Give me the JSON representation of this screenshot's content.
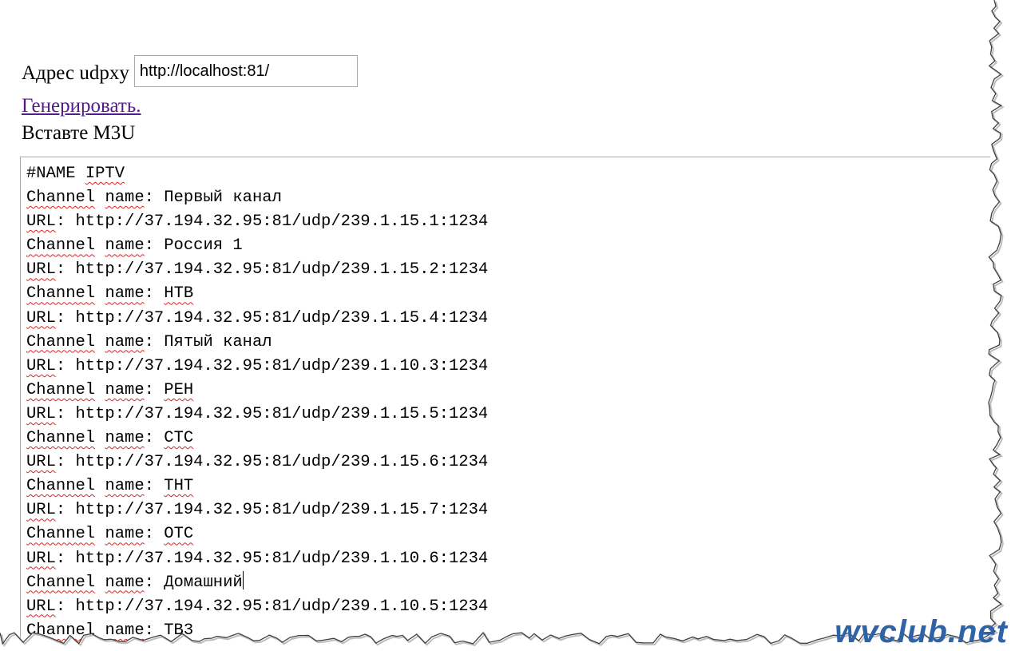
{
  "form": {
    "address_label": "Адрес udpxy",
    "address_value": "http://localhost:81/",
    "generate_link": "Генерировать.",
    "m3u_label": "Вставте M3U"
  },
  "textarea": {
    "lines": [
      {
        "parts": [
          {
            "text": "#NAME",
            "spell": false
          },
          {
            "text": " ",
            "spell": false
          },
          {
            "text": "IPTV",
            "spell": true
          }
        ]
      },
      {
        "parts": [
          {
            "text": "Channel",
            "spell": true
          },
          {
            "text": " ",
            "spell": false
          },
          {
            "text": "name",
            "spell": true
          },
          {
            "text": ": Первый канал",
            "spell": false
          }
        ]
      },
      {
        "parts": [
          {
            "text": "URL",
            "spell": true
          },
          {
            "text": ": http://37.194.32.95:81/udp/239.1.15.1:1234",
            "spell": false
          }
        ]
      },
      {
        "parts": [
          {
            "text": "Channel",
            "spell": true
          },
          {
            "text": " ",
            "spell": false
          },
          {
            "text": "name",
            "spell": true
          },
          {
            "text": ": Россия 1",
            "spell": false
          }
        ]
      },
      {
        "parts": [
          {
            "text": "URL",
            "spell": true
          },
          {
            "text": ": http://37.194.32.95:81/udp/239.1.15.2:1234",
            "spell": false
          }
        ]
      },
      {
        "parts": [
          {
            "text": "Channel",
            "spell": true
          },
          {
            "text": " ",
            "spell": false
          },
          {
            "text": "name",
            "spell": true
          },
          {
            "text": ": ",
            "spell": false
          },
          {
            "text": "НТВ",
            "spell": true
          }
        ]
      },
      {
        "parts": [
          {
            "text": "URL",
            "spell": true
          },
          {
            "text": ": http://37.194.32.95:81/udp/239.1.15.4:1234",
            "spell": false
          }
        ]
      },
      {
        "parts": [
          {
            "text": "Channel",
            "spell": true
          },
          {
            "text": " ",
            "spell": false
          },
          {
            "text": "name",
            "spell": true
          },
          {
            "text": ": Пятый канал",
            "spell": false
          }
        ]
      },
      {
        "parts": [
          {
            "text": "URL",
            "spell": true
          },
          {
            "text": ": http://37.194.32.95:81/udp/239.1.10.3:1234",
            "spell": false
          }
        ]
      },
      {
        "parts": [
          {
            "text": "Channel",
            "spell": true
          },
          {
            "text": " ",
            "spell": false
          },
          {
            "text": "name",
            "spell": true
          },
          {
            "text": ": ",
            "spell": false
          },
          {
            "text": "РЕН",
            "spell": true
          }
        ]
      },
      {
        "parts": [
          {
            "text": "URL",
            "spell": true
          },
          {
            "text": ": http://37.194.32.95:81/udp/239.1.15.5:1234",
            "spell": false
          }
        ]
      },
      {
        "parts": [
          {
            "text": "Channel",
            "spell": true
          },
          {
            "text": " ",
            "spell": false
          },
          {
            "text": "name",
            "spell": true
          },
          {
            "text": ": ",
            "spell": false
          },
          {
            "text": "СТС",
            "spell": true
          }
        ]
      },
      {
        "parts": [
          {
            "text": "URL",
            "spell": true
          },
          {
            "text": ": http://37.194.32.95:81/udp/239.1.15.6:1234",
            "spell": false
          }
        ]
      },
      {
        "parts": [
          {
            "text": "Channel",
            "spell": true
          },
          {
            "text": " ",
            "spell": false
          },
          {
            "text": "name",
            "spell": true
          },
          {
            "text": ": ",
            "spell": false
          },
          {
            "text": "ТНТ",
            "spell": true
          }
        ]
      },
      {
        "parts": [
          {
            "text": "URL",
            "spell": true
          },
          {
            "text": ": http://37.194.32.95:81/udp/239.1.15.7:1234",
            "spell": false
          }
        ]
      },
      {
        "parts": [
          {
            "text": "Channel",
            "spell": true
          },
          {
            "text": " ",
            "spell": false
          },
          {
            "text": "name",
            "spell": true
          },
          {
            "text": ": ",
            "spell": false
          },
          {
            "text": "ОТС",
            "spell": true
          }
        ]
      },
      {
        "parts": [
          {
            "text": "URL",
            "spell": true
          },
          {
            "text": ": http://37.194.32.95:81/udp/239.1.10.6:1234",
            "spell": false
          }
        ]
      },
      {
        "parts": [
          {
            "text": "Channel",
            "spell": true
          },
          {
            "text": " ",
            "spell": false
          },
          {
            "text": "name",
            "spell": true
          },
          {
            "text": ": Домашний",
            "spell": false
          }
        ],
        "caret": true
      },
      {
        "parts": [
          {
            "text": "URL",
            "spell": true
          },
          {
            "text": ": http://37.194.32.95:81/udp/239.1.10.5:1234",
            "spell": false
          }
        ]
      },
      {
        "parts": [
          {
            "text": "Channel",
            "spell": true
          },
          {
            "text": " ",
            "spell": false
          },
          {
            "text": "name",
            "spell": true
          },
          {
            "text": ": ТВ3",
            "spell": false
          }
        ]
      }
    ]
  },
  "watermark": "wvclub.net",
  "colors": {
    "link": "#551a8b",
    "spellcheck": "#e02020",
    "watermark": "#2f63a8",
    "border": "#a9a9a9"
  }
}
